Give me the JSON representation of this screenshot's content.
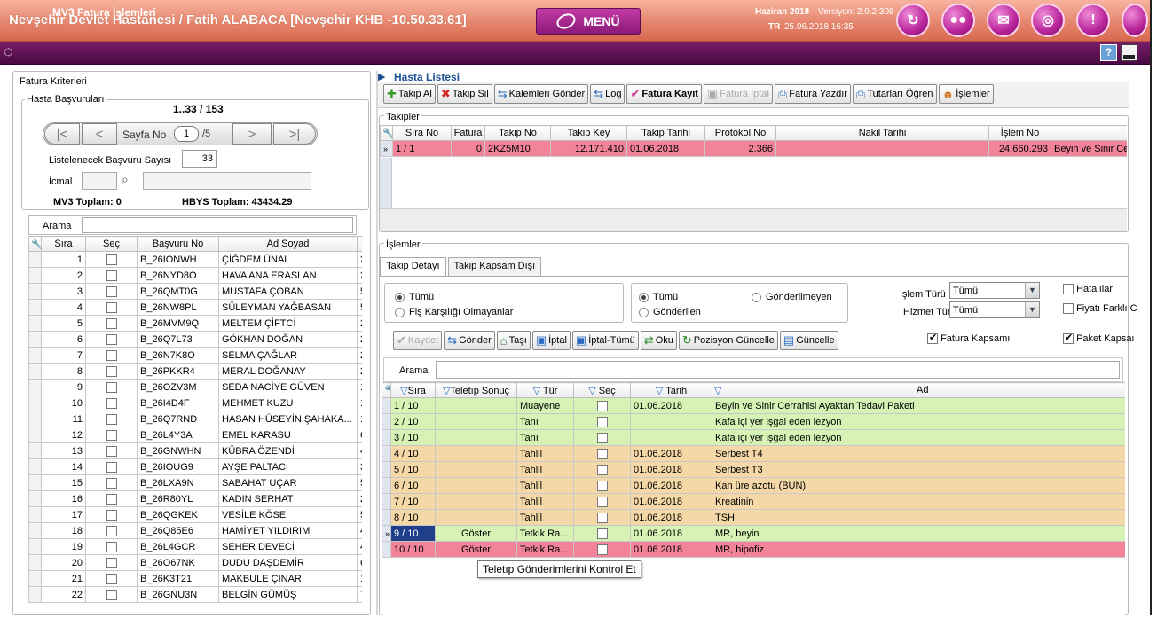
{
  "window": {
    "title": "Nevşehir Devlet Hastanesi / Fatih ALABACA [Nevşehir KHB -10.50.33.61]",
    "menu_label": "MENÜ",
    "date_label": "Haziran 2018",
    "version": "Versiyon: 2.0.2.308",
    "lang": "TR",
    "datetime": "25.06.2018  16:35",
    "module_title": "MV3 Fatura İşlemleri",
    "help": "?",
    "colors": {
      "topbar": "#e6866e",
      "secbar": "#5a0f52",
      "row_green": "#d6f2b4",
      "row_orange": "#f5d8a7",
      "row_pink": "#f2849a"
    }
  },
  "left": {
    "group_title": "Fatura Kriterleri",
    "sub_title": "Hasta Başvuruları",
    "record_range": "1..33 / 153",
    "page_label": "Sayfa No",
    "page_no": "1",
    "page_total": "/5",
    "list_count_label": "Listelenecek Başvuru Sayısı",
    "list_count": "33",
    "icmal_label": "İcmal",
    "mv3_total": "MV3 Toplam: 0",
    "hbys_total": "HBYS Toplam: 43434.29",
    "search_label": "Arama",
    "columns": [
      "Sıra",
      "Seç",
      "Başvuru No",
      "Ad Soyad"
    ],
    "rows": [
      {
        "sira": "1",
        "no": "B_26IONWH",
        "ad": "ÇİĞDEM ÜNAL",
        "x": "2"
      },
      {
        "sira": "2",
        "no": "B_26NYD8O",
        "ad": "HAVA ANA ERASLAN",
        "x": "2"
      },
      {
        "sira": "3",
        "no": "B_26QMT0G",
        "ad": "MUSTAFA ÇOBAN",
        "x": "5"
      },
      {
        "sira": "4",
        "no": "B_26NW8PL",
        "ad": "SÜLEYMAN YAĞBASAN",
        "x": "5"
      },
      {
        "sira": "5",
        "no": "B_26MVM9Q",
        "ad": "MELTEM ÇİFTCİ",
        "x": "2"
      },
      {
        "sira": "6",
        "no": "B_26Q7L73",
        "ad": "GÖKHAN DOĞAN",
        "x": "2"
      },
      {
        "sira": "7",
        "no": "B_26N7K8O",
        "ad": "SELMA ÇAĞLAR",
        "x": "2"
      },
      {
        "sira": "8",
        "no": "B_26PKKR4",
        "ad": "MERAL DOĞANAY",
        "x": "2"
      },
      {
        "sira": "9",
        "no": "B_26OZV3M",
        "ad": "SEDA NACİYE GÜVEN",
        "x": "1"
      },
      {
        "sira": "10",
        "no": "B_26I4D4F",
        "ad": "MEHMET KUZU",
        "x": "1"
      },
      {
        "sira": "11",
        "no": "B_26Q7RND",
        "ad": "HASAN HÜSEYİN ŞAHAKA...",
        "x": "1"
      },
      {
        "sira": "12",
        "no": "B_26L4Y3A",
        "ad": "EMEL KARASU",
        "x": "6"
      },
      {
        "sira": "13",
        "no": "B_26GNWHN",
        "ad": "KÜBRA ÖZENDİ",
        "x": "4"
      },
      {
        "sira": "14",
        "no": "B_26IOUG9",
        "ad": "AYŞE PALTACI",
        "x": "3"
      },
      {
        "sira": "15",
        "no": "B_26LXA9N",
        "ad": "SABAHAT UÇAR",
        "x": "5"
      },
      {
        "sira": "16",
        "no": "B_26R80YL",
        "ad": "KADIN SERHAT",
        "x": "2"
      },
      {
        "sira": "17",
        "no": "B_26QGKEK",
        "ad": "VESİLE KÖSE",
        "x": "5"
      },
      {
        "sira": "18",
        "no": "B_26Q85E6",
        "ad": "HAMİYET YILDIRIM",
        "x": "4"
      },
      {
        "sira": "19",
        "no": "B_26L4GCR",
        "ad": "SEHER DEVECİ",
        "x": "4"
      },
      {
        "sira": "20",
        "no": "B_26O67NK",
        "ad": "DUDU DAŞDEMİR",
        "x": "6"
      },
      {
        "sira": "21",
        "no": "B_26K3T21",
        "ad": "MAKBULE ÇINAR",
        "x": "1"
      },
      {
        "sira": "22",
        "no": "B_26GNU3N",
        "ad": "BELGİN GÜMÜŞ",
        "x": "7"
      }
    ]
  },
  "right": {
    "title": "Hasta Listesi",
    "toolbar": [
      "Takip Al",
      "Takip Sil",
      "Kalemleri Gönder",
      "Log",
      "Fatura Kayıt",
      "Fatura İptal",
      "Fatura Yazdır",
      "Tutarları Öğren",
      "İşlemler"
    ],
    "takipler_title": "Takipler",
    "takip_columns": [
      "Sıra No",
      "Fatura",
      "Takip No",
      "Takip Key",
      "Takip Tarihi",
      "Protokol No",
      "Nakil Tarihi",
      "İşlem No",
      ""
    ],
    "takip_row": [
      "1 / 1",
      "0",
      "2KZ5M10",
      "12.171.410",
      "01.06.2018",
      "2.366",
      "",
      "24.660.293",
      "Beyin ve Sinir Cer"
    ],
    "islemler_title": "İşlemler",
    "tabs": [
      "Takip Detayı",
      "Takip Kapsam Dışı"
    ],
    "radio1": [
      "Tümü",
      "Fiş Karşılığı Olmayanlar"
    ],
    "radio2": [
      "Tümü",
      "Gönderilmeyen",
      "Gönderilen"
    ],
    "islem_turu_label": "İşlem Türü",
    "islem_turu": "Tümü",
    "hizmet_turu_label": "Hizmet Türü",
    "hizmet_turu": "Tümü",
    "hatalilar": "Hatalılar",
    "fiyati_farkli": "Fiyatı Farklı C",
    "buttons": [
      "Kaydet",
      "Gönder",
      "Taşı",
      "İptal",
      "İptal-Tümü",
      "Oku",
      "Pozisyon Güncelle",
      "Güncelle"
    ],
    "fatura_kapsami": "Fatura Kapsamı",
    "paket_kapsami": "Paket Kapsaı",
    "search_label": "Arama",
    "detail_columns": [
      "Sıra",
      "Teletıp Sonuç",
      "Tür",
      "Seç",
      "Tarih",
      "Ad"
    ],
    "detail_rows": [
      {
        "sira": "1 / 10",
        "sonuc": "",
        "tur": "Muayene",
        "tarih": "01.06.2018",
        "ad": "Beyin ve Sinir Cerrahisi Ayaktan Tedavi Paketi",
        "color": "green"
      },
      {
        "sira": "2 / 10",
        "sonuc": "",
        "tur": "Tanı",
        "tarih": "",
        "ad": "Kafa içi yer işgal eden lezyon",
        "color": "green"
      },
      {
        "sira": "3 / 10",
        "sonuc": "",
        "tur": "Tanı",
        "tarih": "",
        "ad": "Kafa içi yer işgal eden lezyon",
        "color": "green"
      },
      {
        "sira": "4 / 10",
        "sonuc": "",
        "tur": "Tahlil",
        "tarih": "01.06.2018",
        "ad": "Serbest T4",
        "color": "orange"
      },
      {
        "sira": "5 / 10",
        "sonuc": "",
        "tur": "Tahlil",
        "tarih": "01.06.2018",
        "ad": "Serbest T3",
        "color": "orange"
      },
      {
        "sira": "6 / 10",
        "sonuc": "",
        "tur": "Tahlil",
        "tarih": "01.06.2018",
        "ad": "Kan üre azotu (BUN)",
        "color": "orange"
      },
      {
        "sira": "7 / 10",
        "sonuc": "",
        "tur": "Tahlil",
        "tarih": "01.06.2018",
        "ad": "Kreatinin",
        "color": "orange"
      },
      {
        "sira": "8 / 10",
        "sonuc": "",
        "tur": "Tahlil",
        "tarih": "01.06.2018",
        "ad": "TSH",
        "color": "orange"
      },
      {
        "sira": "9 / 10",
        "sonuc": "Göster",
        "tur": "Tetkik Ra...",
        "tarih": "01.06.2018",
        "ad": "MR, beyin",
        "color": "green"
      },
      {
        "sira": "10 / 10",
        "sonuc": "Göster",
        "tur": "Tetkik Ra...",
        "tarih": "01.06.2018",
        "ad": "MR, hipofiz",
        "color": "pink"
      }
    ],
    "tooltip": "Teletıp Gönderimlerini Kontrol Et"
  }
}
